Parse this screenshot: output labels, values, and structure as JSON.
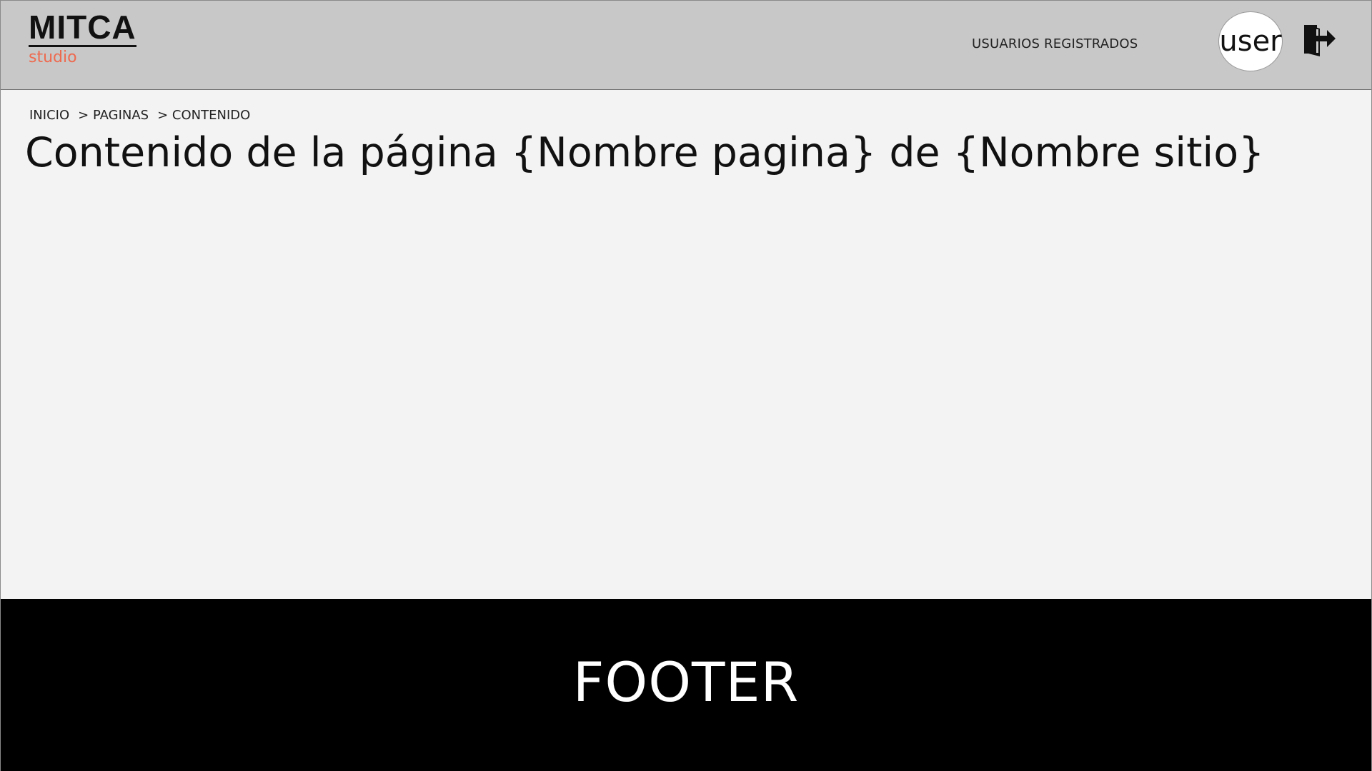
{
  "header": {
    "logo_main": "MITCA",
    "logo_sub": "studio",
    "nav_link": "USUARIOS REGISTRADOS",
    "avatar_label": "user",
    "logout_icon": "logout-icon"
  },
  "breadcrumb": [
    {
      "label": "INICIO"
    },
    {
      "label": "> PAGINAS"
    },
    {
      "label": "> CONTENIDO"
    }
  ],
  "main": {
    "title": "Contenido de la página {Nombre pagina} de {Nombre sitio}"
  },
  "footer": {
    "label": "FOOTER"
  },
  "colors": {
    "header_bg": "#c8c8c8",
    "page_bg": "#f3f3f3",
    "logo_accent": "#ee6a4f",
    "footer_bg": "#000000"
  }
}
